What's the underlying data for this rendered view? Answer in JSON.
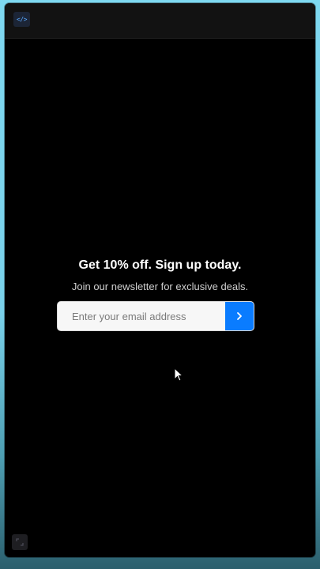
{
  "toolbar": {
    "code_icon_glyph": "</>"
  },
  "newsletter": {
    "headline": "Get 10% off. Sign up today.",
    "subline": "Join our newsletter for exclusive deals.",
    "email_placeholder": "Enter your email address",
    "submit_icon": "chevron-right-icon"
  },
  "colors": {
    "accent": "#0a7cff",
    "panel_background": "#000000",
    "topbar_background": "#121212"
  }
}
